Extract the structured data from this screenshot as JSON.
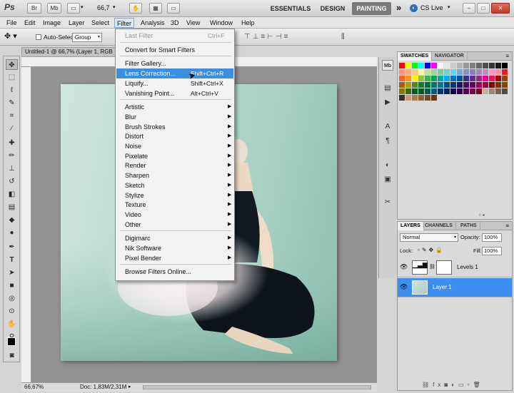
{
  "topbar": {
    "logo": "Ps",
    "br": "Br",
    "mb": "Mb",
    "zoom": "66,7",
    "zoom_arrow": "▾",
    "workspaces": [
      "ESSENTIALS",
      "DESIGN",
      "PAINTING"
    ],
    "active_workspace": "PAINTING",
    "more": "»",
    "cslive": "CS Live",
    "cslive_arrow": "▾"
  },
  "menubar": {
    "items": [
      "File",
      "Edit",
      "Image",
      "Layer",
      "Select",
      "Filter",
      "Analysis",
      "3D",
      "View",
      "Window",
      "Help"
    ],
    "open_item": "Filter"
  },
  "options": {
    "auto_select_label": "Auto-Select:",
    "auto_select_value": "Group"
  },
  "document": {
    "tab_title": "Untitled-1 @ 66,7% (Layer 1, RGB",
    "status_zoom": "66,67%",
    "status_doc": "Doc: 1,83M/2,31M"
  },
  "filter_menu": {
    "items": [
      {
        "label": "Last Filter",
        "shortcut": "Ctrl+F",
        "disabled": true
      },
      {
        "sep": true
      },
      {
        "label": "Convert for Smart Filters"
      },
      {
        "sep": true
      },
      {
        "label": "Filter Gallery..."
      },
      {
        "label": "Lens Correction...",
        "shortcut": "Shift+Ctrl+R",
        "highlighted": true
      },
      {
        "label": "Liquify...",
        "shortcut": "Shift+Ctrl+X"
      },
      {
        "label": "Vanishing Point...",
        "shortcut": "Alt+Ctrl+V"
      },
      {
        "sep": true
      },
      {
        "label": "Artistic",
        "submenu": true
      },
      {
        "label": "Blur",
        "submenu": true
      },
      {
        "label": "Brush Strokes",
        "submenu": true
      },
      {
        "label": "Distort",
        "submenu": true
      },
      {
        "label": "Noise",
        "submenu": true
      },
      {
        "label": "Pixelate",
        "submenu": true
      },
      {
        "label": "Render",
        "submenu": true
      },
      {
        "label": "Sharpen",
        "submenu": true
      },
      {
        "label": "Sketch",
        "submenu": true
      },
      {
        "label": "Stylize",
        "submenu": true
      },
      {
        "label": "Texture",
        "submenu": true
      },
      {
        "label": "Video",
        "submenu": true
      },
      {
        "label": "Other",
        "submenu": true
      },
      {
        "sep": true
      },
      {
        "label": "Digimarc",
        "submenu": true
      },
      {
        "label": "Nik Software",
        "submenu": true
      },
      {
        "label": "Pixel Bender",
        "submenu": true
      },
      {
        "sep": true
      },
      {
        "label": "Browse Filters Online..."
      }
    ]
  },
  "swatches_panel": {
    "tabs": [
      "SWATCHES",
      "NAVIGATOR"
    ],
    "colors": [
      "#ff0000",
      "#ffff00",
      "#00ff00",
      "#00ffff",
      "#0000ff",
      "#ff00ff",
      "#ffffff",
      "#e6e6e6",
      "#cccccc",
      "#b3b3b3",
      "#999999",
      "#808080",
      "#666666",
      "#4d4d4d",
      "#333333",
      "#1a1a1a",
      "#000000",
      "#f7977a",
      "#f9ad81",
      "#fdc68a",
      "#fff79a",
      "#c4df9b",
      "#a2d39c",
      "#82ca9d",
      "#7bcdc8",
      "#6ecff6",
      "#7ea7d8",
      "#8493ca",
      "#8882be",
      "#a187be",
      "#bc8dbf",
      "#f49ac2",
      "#f6989d",
      "#ed1c24",
      "#f26522",
      "#f7941d",
      "#fff200",
      "#8dc73f",
      "#39b54a",
      "#00a651",
      "#00a99d",
      "#00aeef",
      "#0072bc",
      "#0054a6",
      "#2e3192",
      "#662d91",
      "#92278f",
      "#ec008c",
      "#ed145b",
      "#9e0b0f",
      "#a0410d",
      "#a36209",
      "#aba000",
      "#598527",
      "#1a7b30",
      "#007236",
      "#00746b",
      "#0076a3",
      "#004a80",
      "#003471",
      "#1b1464",
      "#440e62",
      "#630460",
      "#9e005d",
      "#9e0039",
      "#790000",
      "#7b2e00",
      "#7d4900",
      "#827b00",
      "#406618",
      "#005e20",
      "#005826",
      "#005952",
      "#005b7f",
      "#003663",
      "#002157",
      "#0d004c",
      "#32004b",
      "#4b0049",
      "#7b0046",
      "#7a0026",
      "#c7b299",
      "#998675",
      "#736357",
      "#534741",
      "#37302d",
      "#c69c6d",
      "#a67c52",
      "#8c6239",
      "#754c24",
      "#603913"
    ]
  },
  "layers_panel": {
    "tabs": [
      "LAYERS",
      "CHANNELS",
      "PATHS"
    ],
    "blend_mode": "Normal",
    "opacity_label": "Opacity:",
    "opacity": "100%",
    "lock_label": "Lock:",
    "fill_label": "Fill:",
    "fill": "100%",
    "layers": [
      {
        "name": "Levels 1",
        "selected": false
      },
      {
        "name": "Layer 1",
        "selected": true
      }
    ]
  },
  "icons": {
    "move": "move-tool-icon",
    "eye": "eye-icon"
  }
}
